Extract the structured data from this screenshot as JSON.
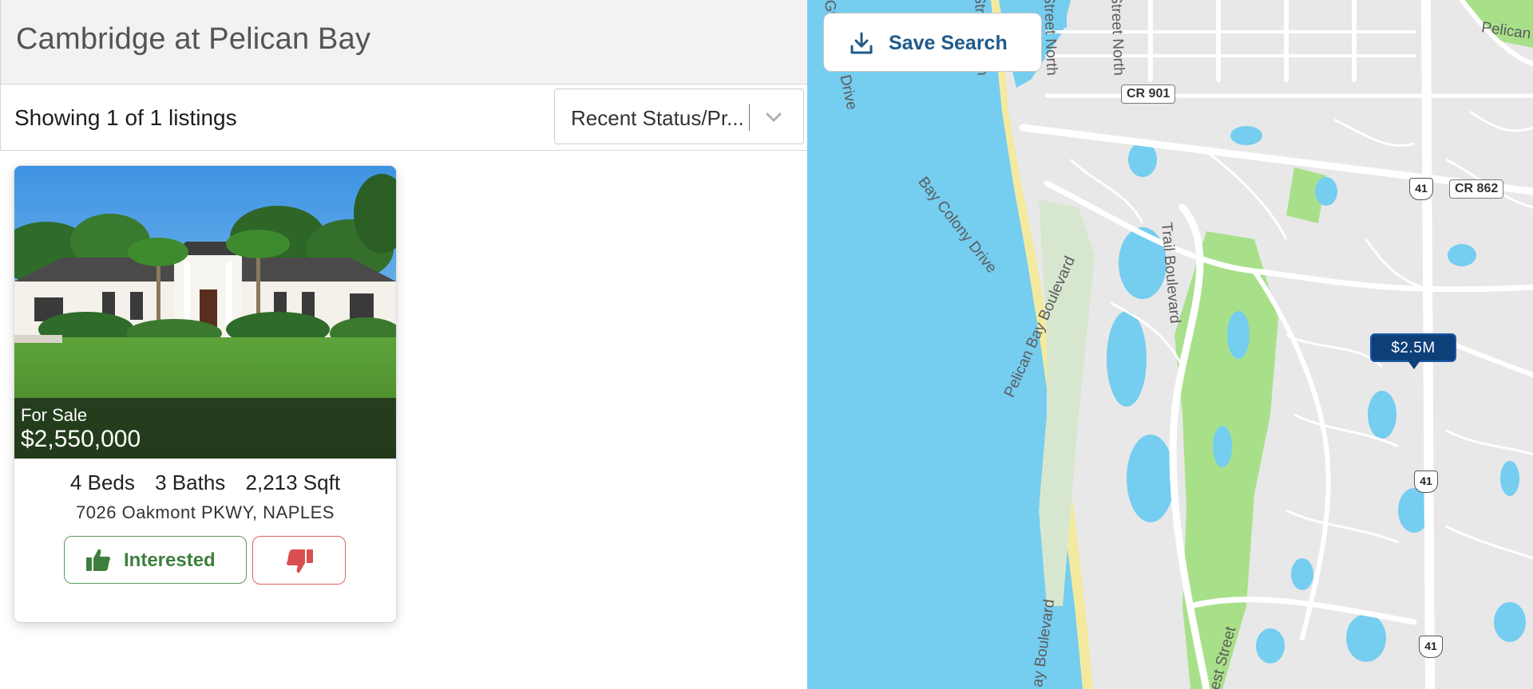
{
  "page": {
    "title": "Cambridge at Pelican Bay"
  },
  "toolbar": {
    "count_text": "Showing 1 of 1 listings",
    "sort_value": "Recent Status/Pr..."
  },
  "listing": {
    "status": "For Sale",
    "price": "$2,550,000",
    "beds": "4 Beds",
    "baths": "3 Baths",
    "sqft": "2,213 Sqft",
    "address": "7026 Oakmont PKWY, NAPLES",
    "interested_label": "Interested"
  },
  "map": {
    "save_search_label": "Save Search",
    "pin_price": "$2.5M",
    "labels": {
      "gulf_shore": "Gulf Shore Drive",
      "street_north_1": "Street North",
      "street_north_2": "Street North",
      "street_north_3": "Street North",
      "bay_colony": "Bay Colony Drive",
      "pelican_bay_blvd": "Pelican Bay Boulevard",
      "trail_blvd": "Trail Boulevard",
      "bay_blvd_bottom": "ay Boulevard",
      "west_street": "est Street",
      "pelican_top": "Pelican"
    },
    "shields": {
      "cr901": "CR 901",
      "cr862": "CR 862",
      "us41_top": "41",
      "us41_mid": "41",
      "us41_bottom": "41"
    },
    "colors": {
      "water": "#75cdf0",
      "land": "#e8e8e8",
      "park": "#a8e08a",
      "pin": "#0d3f78"
    }
  },
  "icons": {
    "download": "download-icon",
    "thumbs_up": "thumbs-up-icon",
    "thumbs_down": "thumbs-down-icon",
    "chevron": "chevron-down-icon"
  }
}
